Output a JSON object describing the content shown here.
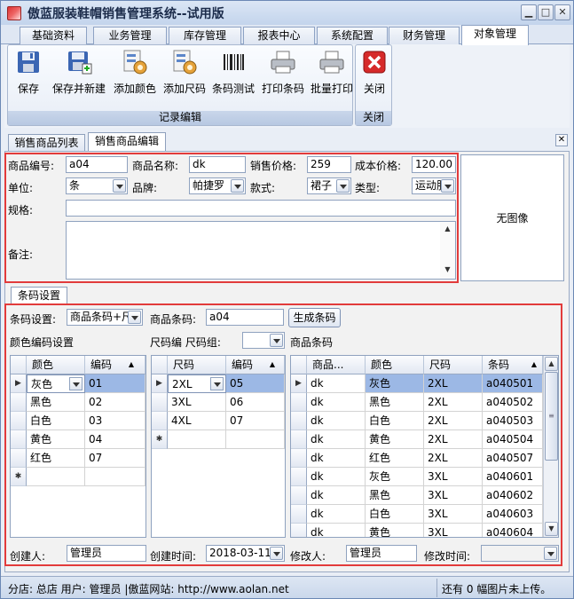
{
  "window": {
    "title": "傲蓝服装鞋帽销售管理系统--试用版"
  },
  "menu_tabs": [
    {
      "label": "基础资料"
    },
    {
      "label": "业务管理"
    },
    {
      "label": "库存管理"
    },
    {
      "label": "报表中心"
    },
    {
      "label": "系统配置"
    },
    {
      "label": "财务管理"
    },
    {
      "label": "对象管理"
    }
  ],
  "ribbon": {
    "group1_label": "记录编辑",
    "group2_label": "关闭",
    "buttons": [
      {
        "label": "保存",
        "icon": "floppy-icon"
      },
      {
        "label": "保存并新建",
        "icon": "floppy-new-icon"
      },
      {
        "label": "添加颜色",
        "icon": "color-config-icon"
      },
      {
        "label": "添加尺码",
        "icon": "size-config-icon"
      },
      {
        "label": "条码测试",
        "icon": "barcode-icon"
      },
      {
        "label": "打印条码",
        "icon": "printer-icon"
      },
      {
        "label": "批量打印",
        "icon": "printer-batch-icon"
      }
    ],
    "close_label": "关闭"
  },
  "sub_tabs": [
    {
      "label": "销售商品列表"
    },
    {
      "label": "销售商品编辑"
    }
  ],
  "form": {
    "code_label": "商品编号:",
    "code_value": "a04",
    "name_label": "商品名称:",
    "name_value": "dk",
    "price_label": "销售价格:",
    "price_value": "259",
    "cost_label": "成本价格:",
    "cost_value": "120.00",
    "unit_label": "单位:",
    "unit_value": "条",
    "brand_label": "品牌:",
    "brand_value": "帕捷罗",
    "style_label": "款式:",
    "style_value": "裙子",
    "type_label": "类型:",
    "type_value": "运动服",
    "spec_label": "规格:",
    "spec_value": "",
    "note_label": "备注:",
    "note_value": "",
    "no_image": "无图像"
  },
  "barcode": {
    "tab_label": "条码设置",
    "setting_label": "条码设置:",
    "setting_value": "商品条码+尺",
    "goods_barcode_label": "商品条码:",
    "goods_barcode_value": "a04",
    "generate_button": "生成条码",
    "color_section": "颜色编码设置",
    "size_section": "尺码编 尺码组:",
    "barcode_section": "商品条码",
    "color_grid": {
      "headers": [
        "颜色",
        "编码"
      ],
      "rows": [
        [
          "灰色",
          "01"
        ],
        [
          "黑色",
          "02"
        ],
        [
          "白色",
          "03"
        ],
        [
          "黄色",
          "04"
        ],
        [
          "红色",
          "07"
        ]
      ]
    },
    "size_grid": {
      "headers": [
        "尺码",
        "编码"
      ],
      "rows": [
        [
          "2XL",
          "05"
        ],
        [
          "3XL",
          "06"
        ],
        [
          "4XL",
          "07"
        ]
      ]
    },
    "barcode_grid": {
      "headers": [
        "商品...",
        "颜色",
        "尺码",
        "条码"
      ],
      "rows": [
        [
          "dk",
          "灰色",
          "2XL",
          "a040501"
        ],
        [
          "dk",
          "黑色",
          "2XL",
          "a040502"
        ],
        [
          "dk",
          "白色",
          "2XL",
          "a040503"
        ],
        [
          "dk",
          "黄色",
          "2XL",
          "a040504"
        ],
        [
          "dk",
          "红色",
          "2XL",
          "a040507"
        ],
        [
          "dk",
          "灰色",
          "3XL",
          "a040601"
        ],
        [
          "dk",
          "黑色",
          "3XL",
          "a040602"
        ],
        [
          "dk",
          "白色",
          "3XL",
          "a040603"
        ],
        [
          "dk",
          "黄色",
          "3XL",
          "a040604"
        ]
      ]
    },
    "creator_label": "创建人:",
    "creator_value": "管理员",
    "created_label": "创建时间:",
    "created_value": "2018-03-11",
    "modifier_label": "修改人:",
    "modifier_value": "管理员",
    "modified_label": "修改时间:",
    "modified_value": ""
  },
  "status": {
    "left": "分店: 总店  用户: 管理员  |傲蓝网站: http://www.aolan.net",
    "right": "还有 0 幅图片未上传。"
  }
}
